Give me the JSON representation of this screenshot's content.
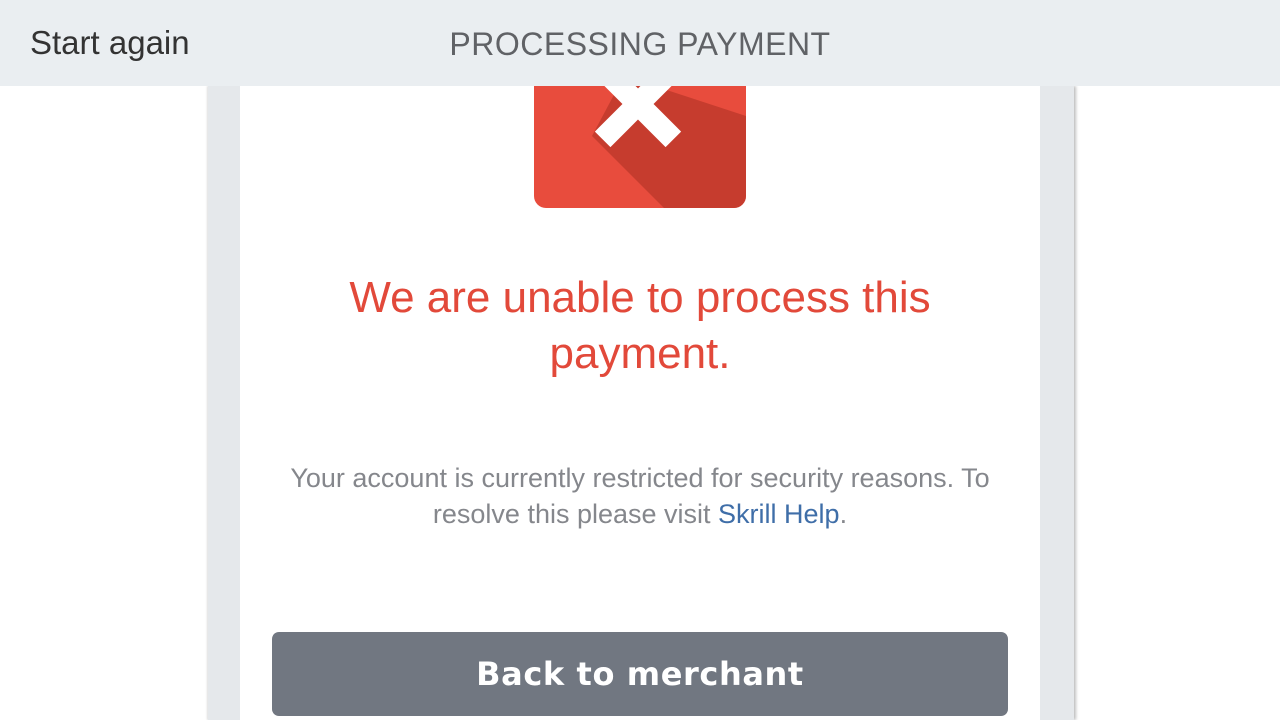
{
  "topbar": {
    "start_again": "Start again",
    "title": "PROCESSING PAYMENT"
  },
  "status": {
    "icon": "error-x-icon",
    "heading": "We are unable to process this payment.",
    "message_before_link": "Your account is currently restricted for security reasons. To resolve this please visit ",
    "link_text": "Skrill Help",
    "message_after_link": "."
  },
  "actions": {
    "back_to_merchant": "Back to merchant"
  },
  "colors": {
    "error_red": "#e2493a",
    "link_blue": "#3f6ea8",
    "button_gray": "#717781",
    "topbar_bg": "#eaeef1"
  }
}
